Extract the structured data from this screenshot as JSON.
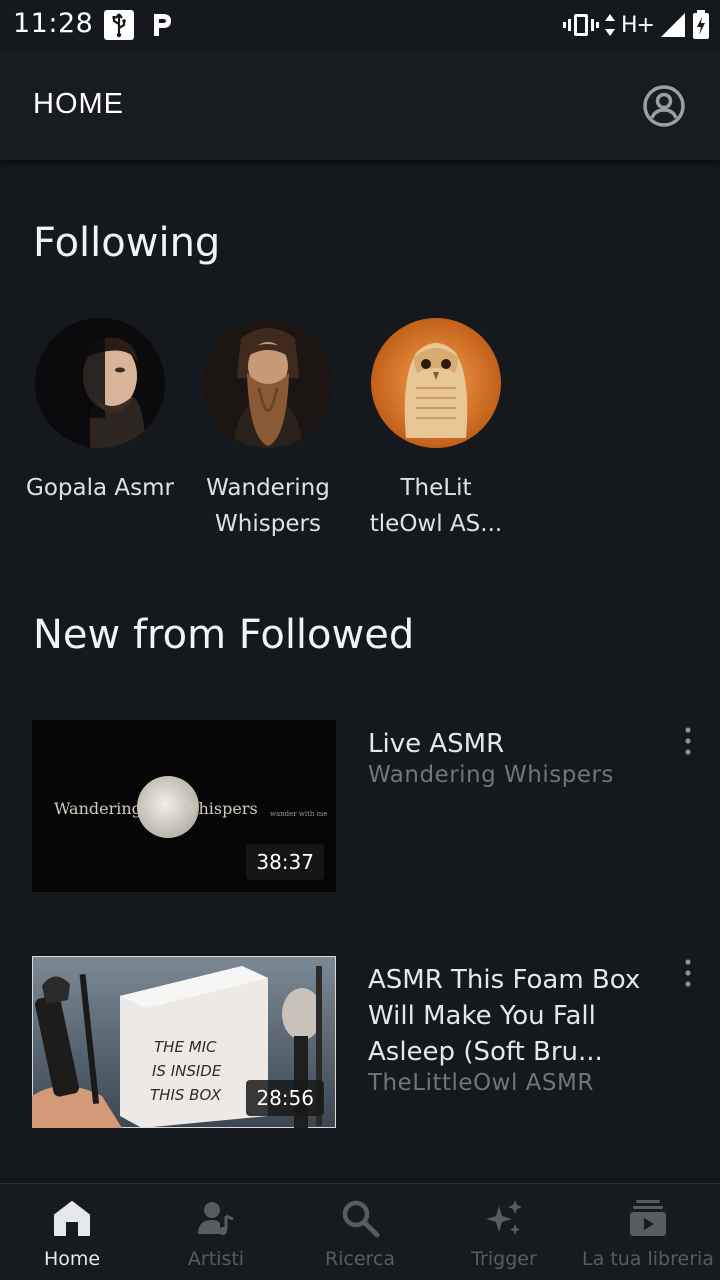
{
  "status_bar": {
    "time": "11:28",
    "network": "H+",
    "icons": [
      "usb-icon",
      "p-icon",
      "vibrate-icon",
      "data-arrows-icon",
      "signal-icon",
      "battery-charging-icon"
    ]
  },
  "app_bar": {
    "title": "HOME",
    "profile_icon": "account-circle-icon"
  },
  "following": {
    "title": "Following",
    "artists": [
      {
        "name": "Gopala Asmr"
      },
      {
        "name": "Wandering Whispers"
      },
      {
        "name": "TheLit tleOwl AS..."
      }
    ]
  },
  "new_from_followed": {
    "title": "New from Followed",
    "videos": [
      {
        "title": "Live ASMR",
        "channel": "Wandering Whispers",
        "duration": "38:37",
        "thumb_text_left": "Wandering",
        "thumb_text_right": "Whispers",
        "thumb_text_small": "wander with me"
      },
      {
        "title": "ASMR This Foam Box Will Make You Fall Asleep (Soft Bru...",
        "channel": "TheLittleOwl ASMR",
        "duration": "28:56",
        "thumb_lines": [
          "THE MIC",
          "IS INSIDE",
          "THIS BOX"
        ]
      }
    ]
  },
  "bottom_nav": {
    "items": [
      {
        "label": "Home",
        "icon": "home-icon",
        "active": true
      },
      {
        "label": "Artisti",
        "icon": "artist-icon",
        "active": false
      },
      {
        "label": "Ricerca",
        "icon": "search-icon",
        "active": false
      },
      {
        "label": "Trigger",
        "icon": "sparkle-icon",
        "active": false
      },
      {
        "label": "La tua libreria",
        "icon": "library-icon",
        "active": false
      }
    ]
  },
  "colors": {
    "background": "#15191d",
    "app_bar": "#181c20",
    "text_primary": "#e9ebec",
    "text_secondary": "#6e767c",
    "nav_inactive": "#555c62"
  }
}
